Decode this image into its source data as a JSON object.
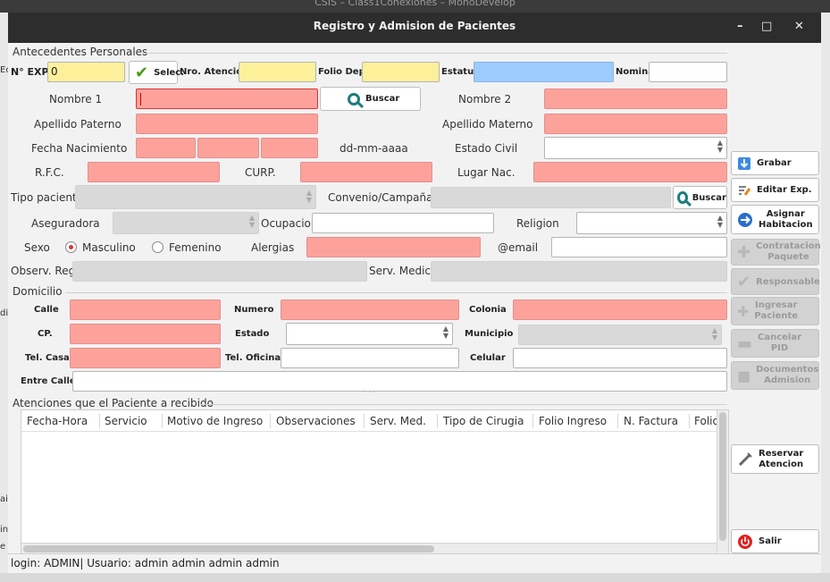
{
  "window": {
    "title": "Registro y Admision de Pacientes",
    "bg_title": "CSIS – Class1Conexiones – MonoDevelop"
  },
  "bg": {
    "frag1": "Ec",
    "frag2": "di",
    "frag3": "ain",
    "frag4": "in.cs",
    "frag5": "e"
  },
  "sections": {
    "personal": "Antecedentes Personales",
    "domicilio": "Domicilio",
    "atenciones": "Atenciones que el Paciente a recibido"
  },
  "personal": {
    "nexp_label": "N° EXP.",
    "nexp_value": "0",
    "selec_label": "Selec.",
    "nro_atencion_label": "Nro. Atencion",
    "folio_dep_label": "Folio Dep.",
    "estatus_label": "Estatus",
    "nomina_label": "Nomina",
    "nombre1_label": "Nombre 1",
    "buscar_label": "Buscar",
    "nombre2_label": "Nombre 2",
    "apellido_paterno_label": "Apellido Paterno",
    "apellido_materno_label": "Apellido Materno",
    "fecha_nac_label": "Fecha Nacimiento",
    "fecha_hint": "dd-mm-aaaa",
    "estado_civil_label": "Estado Civil",
    "rfc_label": "R.F.C.",
    "curp_label": "CURP.",
    "lugar_nac_label": "Lugar Nac.",
    "tipo_paciente_label": "Tipo paciente",
    "convenio_label": "Convenio/Campaña",
    "buscar2_label": "Buscar",
    "aseguradora_label": "Aseguradora",
    "ocupacion_label": "Ocupacion",
    "religion_label": "Religion",
    "sexo_label": "Sexo",
    "masculino_label": "Masculino",
    "femenino_label": "Femenino",
    "alergias_label": "Alergias",
    "email_label": "@email",
    "observ_label": "Observ. Reg.",
    "serv_medico_label": "Serv. Medico"
  },
  "domicilio": {
    "calle_label": "Calle",
    "numero_label": "Numero",
    "colonia_label": "Colonia",
    "cp_label": "CP.",
    "estado_label": "Estado",
    "municipio_label": "Municipio",
    "tel_casa_label": "Tel. Casa",
    "tel_oficina_label": "Tel. Oficina",
    "celular_label": "Celular",
    "entre_calles_label": "Entre Calles"
  },
  "table": {
    "columns": [
      "Fecha-Hora",
      "Servicio",
      "Motivo de Ingreso",
      "Observaciones",
      "Serv. Med.",
      "Tipo de Cirugia",
      "Folio Ingreso",
      "N. Factura",
      "Folio"
    ]
  },
  "side_buttons": {
    "grabar": "Grabar",
    "editar": "Editar Exp.",
    "asignar_1": "Asignar",
    "asignar_2": "Habitacion",
    "contratacion_1": "Contratacion",
    "contratacion_2": "Paquete",
    "responsable": "Responsable",
    "ingresar_1": "Ingresar",
    "ingresar_2": "Paciente",
    "cancelar_1": "Cancelar",
    "cancelar_2": "PID",
    "documentos_1": "Documentos",
    "documentos_2": "Admision",
    "reservar_1": "Reservar",
    "reservar_2": "Atencion",
    "salir": "Salir"
  },
  "status": {
    "text": "login: ADMIN| Usuario: admin admin admin admin"
  },
  "colors": {
    "required": "#fda29b",
    "key": "#fdf09b",
    "status": "#9ecbfd",
    "disabled": "#d9d9d9"
  }
}
